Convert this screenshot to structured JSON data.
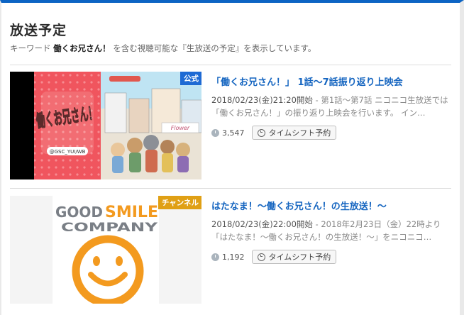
{
  "header": {
    "title": "放送予定",
    "desc_prefix": "キーワード",
    "keyword": "働くお兄さん！",
    "desc_suffix": "を含む視聴可能な『生放送の予定』を表示しています。"
  },
  "items": [
    {
      "badge": "公式",
      "title": "「働くお兄さん！」 1話～7話振り返り上映会",
      "date": "2018/02/23(金)21:20開始",
      "description": " - 第1話～第7話 ニコニコ生放送では「働くお兄さん！」の振り返り上映会を行います。 イン…",
      "views": "3,547",
      "button": "タイムシフト予約",
      "thumb_logo": "働くお兄さん！",
      "thumb_sub": "@GSC_YUI/WB",
      "thumb_sign": "Flower"
    },
    {
      "badge": "チャンネル",
      "title": "はたなま！～働くお兄さん！の生放送！～",
      "date": "2018/02/23(金)22:00開始",
      "description": " - 2018年2月23日（金）22時より「はたなま！～働くお兄さん！の生放送！～」をニコニコ…",
      "views": "1,192",
      "button": "タイムシフト予約",
      "logo_good": "GOOD",
      "logo_smile": "SMILE",
      "logo_company": "COMPANY"
    }
  ],
  "colors": {
    "accent": "#0c64c4",
    "link": "#1565c0",
    "official_badge": "#1e6ad4",
    "channel_badge": "#e0a015",
    "smile_orange": "#f39a1f"
  }
}
